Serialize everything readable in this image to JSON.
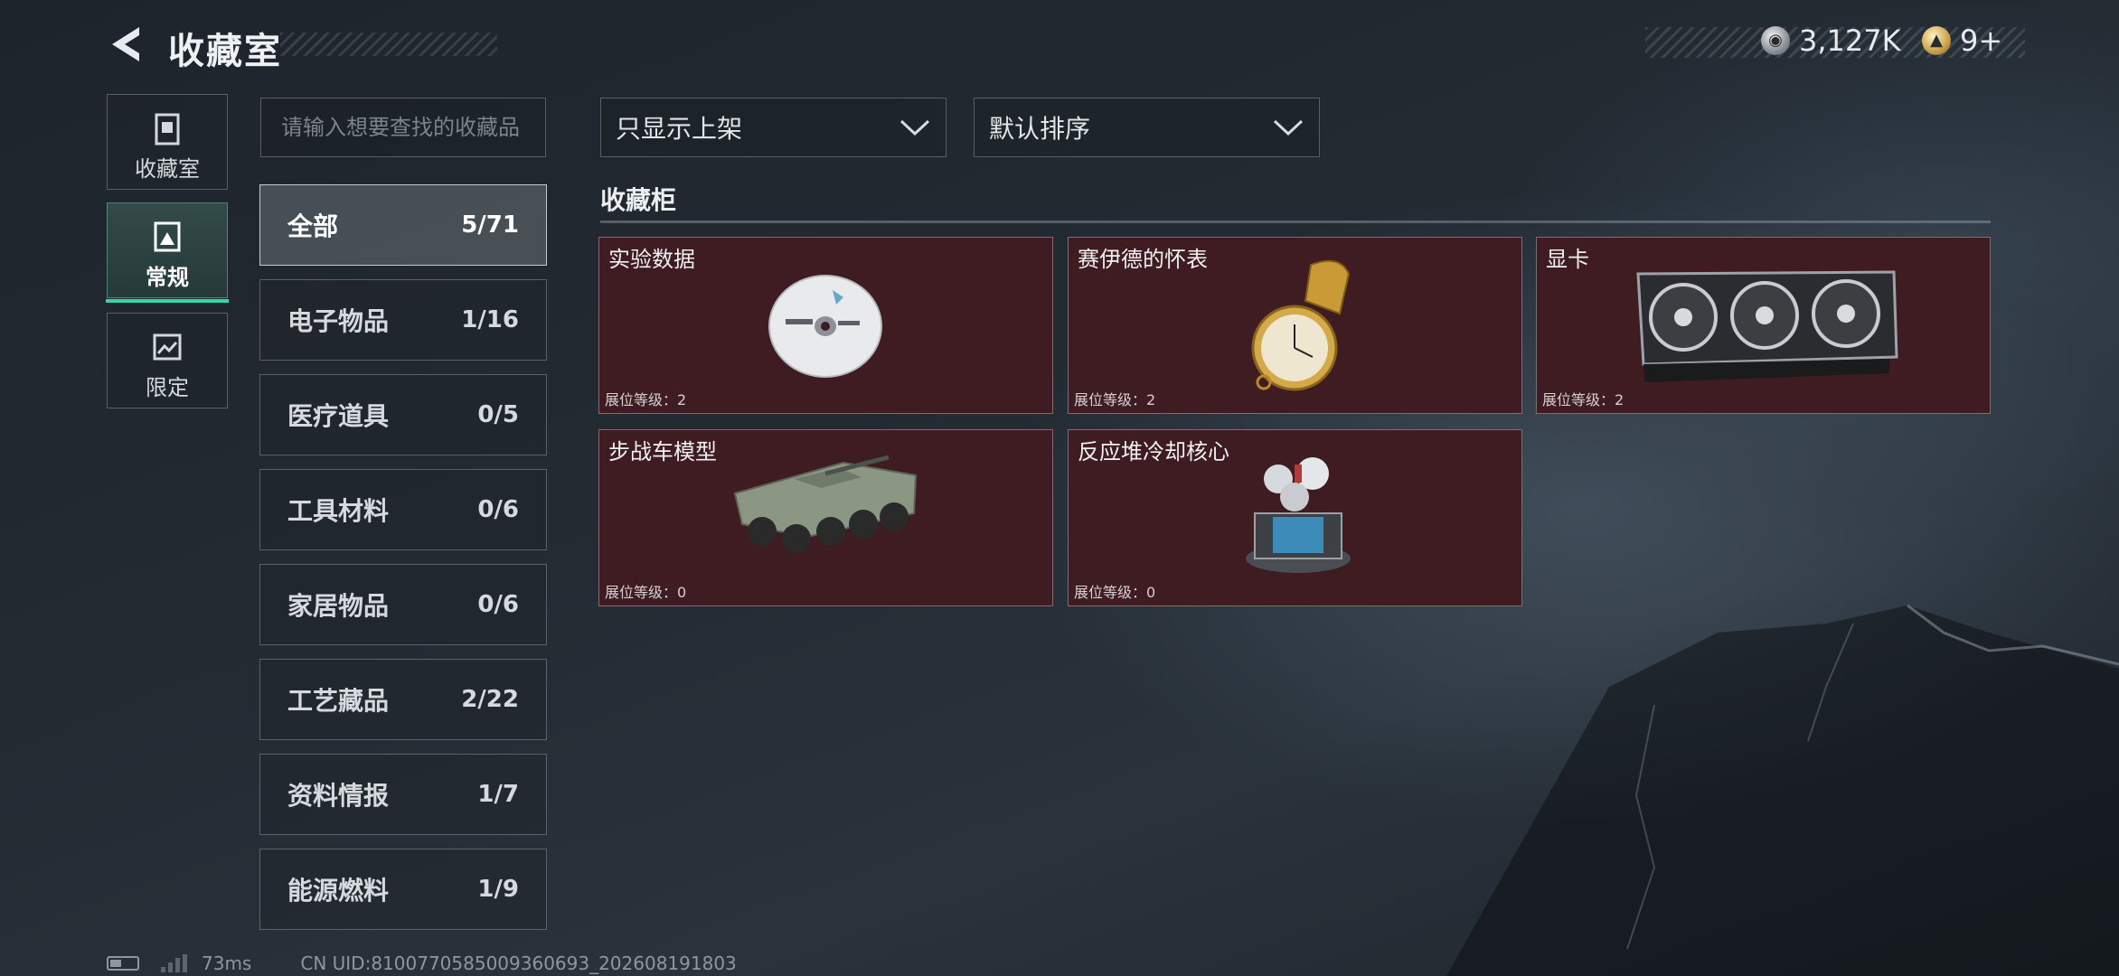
{
  "header": {
    "title": "收藏室",
    "currency_1": "3,127K",
    "currency_2": "9+"
  },
  "side_tabs": [
    {
      "label": "收藏室",
      "icon": "collection-room-icon"
    },
    {
      "label": "常规",
      "icon": "regular-collection-icon",
      "active": true
    },
    {
      "label": "限定",
      "icon": "limited-collection-icon"
    }
  ],
  "search": {
    "placeholder": "请输入想要查找的收藏品"
  },
  "categories": [
    {
      "name": "全部",
      "count": "5/71",
      "active": true
    },
    {
      "name": "电子物品",
      "count": "1/16"
    },
    {
      "name": "医疗道具",
      "count": "0/5"
    },
    {
      "name": "工具材料",
      "count": "0/6"
    },
    {
      "name": "家居物品",
      "count": "0/6"
    },
    {
      "name": "工艺藏品",
      "count": "2/22"
    },
    {
      "name": "资料情报",
      "count": "1/7"
    },
    {
      "name": "能源燃料",
      "count": "1/9"
    }
  ],
  "filters": {
    "display_filter": "只显示上架",
    "sort": "默认排序"
  },
  "section": {
    "title": "收藏柜"
  },
  "items": [
    {
      "name": "实验数据",
      "level": "展位等级：2",
      "image": "cd-disc-image"
    },
    {
      "name": "赛伊德的怀表",
      "level": "展位等级：2",
      "image": "pocket-watch-image"
    },
    {
      "name": "显卡",
      "level": "展位等级：2",
      "image": "graphics-card-image"
    },
    {
      "name": "步战车模型",
      "level": "展位等级：0",
      "image": "ifv-model-image"
    },
    {
      "name": "反应堆冷却核心",
      "level": "展位等级：0",
      "image": "reactor-core-image"
    }
  ],
  "status": {
    "ping": "73ms",
    "uid": "CN UID:8100770585009360693_202608191803"
  },
  "colors": {
    "accent": "#35d6a5",
    "card_bg": "#3e1c21",
    "background": "#232b33"
  }
}
